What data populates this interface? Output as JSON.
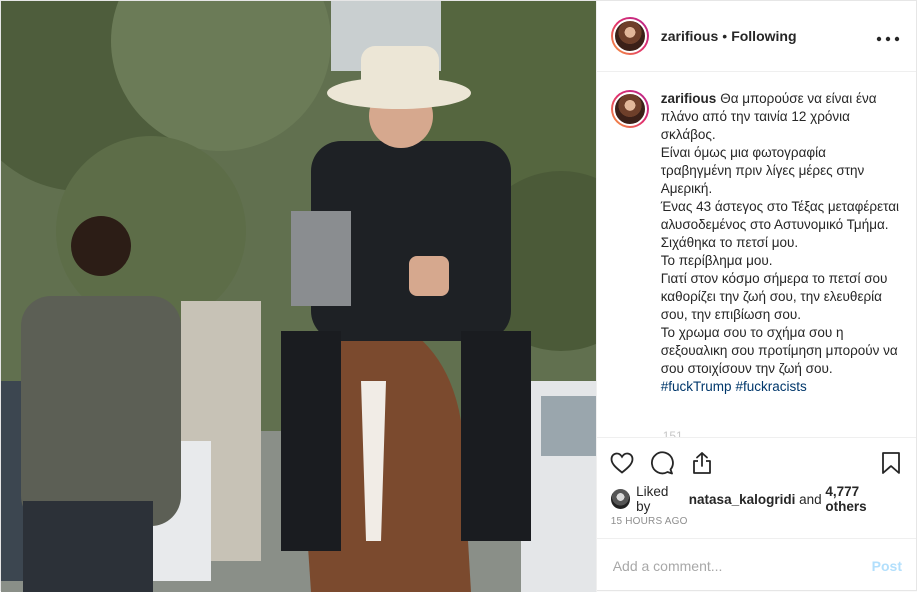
{
  "post": {
    "author": {
      "username": "zarifious",
      "separator": "•",
      "follow_status": "Following"
    },
    "caption": {
      "username": "zarifious",
      "lines": [
        "Θα μπορούσε να είναι ένα πλάνο από την ταινία 12 χρόνια σκλάβος.",
        "Είναι όμως μια φωτογραφία τραβηγμένη πριν λίγες μέρες στην Αμερική.",
        "Ένας 43 άστεγος στο Τέξας μεταφέρεται αλυσοδεμένος στο Αστυνομικό Τμήμα.",
        "Σιχάθηκα το πετσί μου.",
        "Το περίβλημα μου.",
        "Γιατί στον κόσμο σήμερα το πετσί σου καθορίζει την ζωή σου, την ελευθερία σου, την επιβίωση σου.",
        "Το χρωμα σου το σχήμα σου η σεξουαλικη σου προτίμηση μπορούν να σου στοιχίσουν την ζωή σου."
      ],
      "hashtags": [
        "#fuckTrump",
        "#fuckracists"
      ],
      "cut_off_text": "151"
    },
    "likes": {
      "prefix": "Liked by",
      "liker": "natasa_kalogridi",
      "connector": "and",
      "others": "4,777 others"
    },
    "timestamp": "15 HOURS AGO",
    "comment": {
      "placeholder": "Add a comment...",
      "post_label": "Post"
    },
    "icons": {
      "more": "more-options-icon",
      "like": "heart-icon",
      "comment": "comment-bubble-icon",
      "share": "share-icon",
      "save": "bookmark-icon"
    },
    "colors": {
      "hashtag": "#00376b",
      "post_button_disabled": "#b2dffc",
      "secondary_text": "#8e8e8e"
    }
  }
}
